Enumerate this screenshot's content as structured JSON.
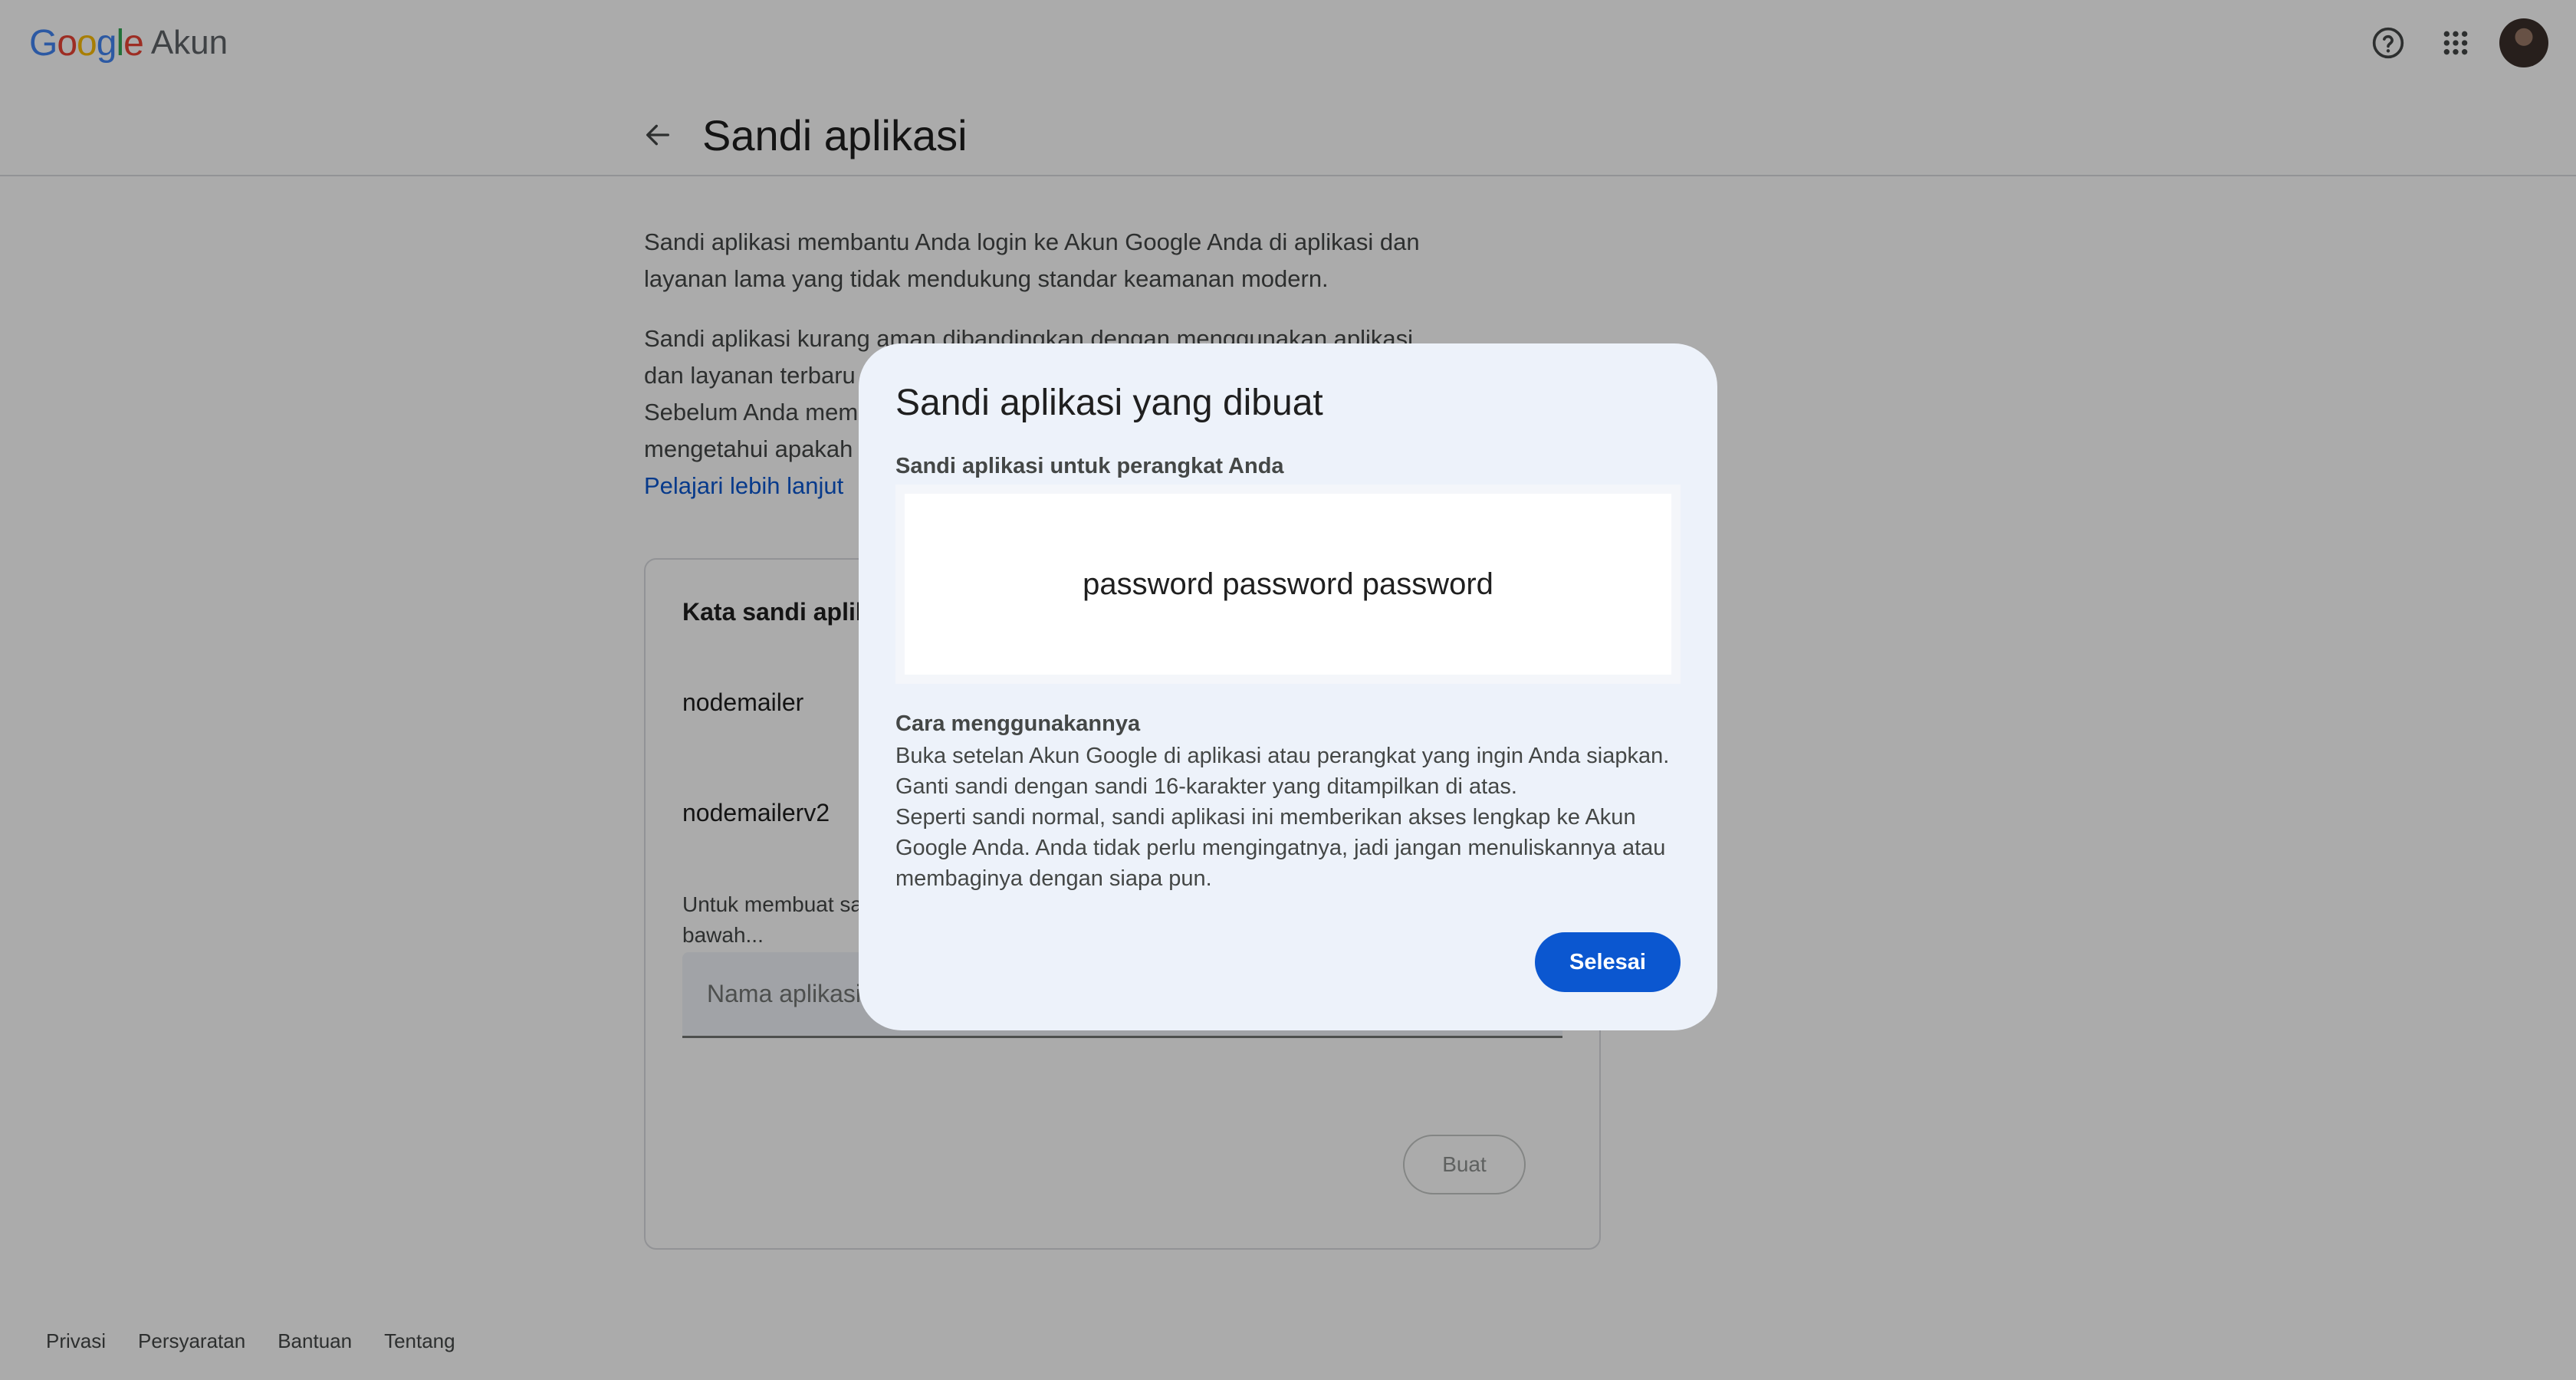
{
  "header": {
    "logo_google": "Google",
    "logo_product": "Akun",
    "help_icon": "help-circle-icon",
    "apps_icon": "apps-grid-icon"
  },
  "page": {
    "title": "Sandi aplikasi",
    "description_1": "Sandi aplikasi membantu Anda login ke Akun Google Anda di aplikasi dan layanan lama yang tidak mendukung standar keamanan modern.",
    "description_2_line1": "Sandi aplikasi kurang aman dibandingkan dengan menggunakan aplikasi",
    "description_2_line2": "dan layanan terbaru",
    "description_2_line3": "Sebelum Anda mem",
    "description_2_line4": "mengetahui apakah",
    "learn_more": "Pelajari lebih lanjut"
  },
  "card": {
    "title": "Kata sandi aplik",
    "apps": [
      "nodemailer",
      "nodemailerv2"
    ],
    "hint_line1": "Untuk membuat sa",
    "hint_line2": "bawah...",
    "input_placeholder": "Nama aplikasi",
    "create_label": "Buat"
  },
  "footer": {
    "links": [
      "Privasi",
      "Persyaratan",
      "Bantuan",
      "Tentang"
    ]
  },
  "dialog": {
    "title": "Sandi aplikasi yang dibuat",
    "subtitle": "Sandi aplikasi untuk perangkat Anda",
    "password": "password password password",
    "how_title": "Cara menggunakannya",
    "how_line1": "Buka setelan Akun Google di aplikasi atau perangkat yang ingin Anda siapkan.",
    "how_line2": "Ganti sandi dengan sandi 16-karakter yang ditampilkan di atas.",
    "how_line3": "Seperti sandi normal, sandi aplikasi ini memberikan akses lengkap ke Akun Google Anda. Anda tidak perlu mengingatnya, jadi jangan menuliskannya atau membaginya dengan siapa pun.",
    "done_label": "Selesai"
  },
  "colors": {
    "primary": "#0b57d0",
    "dialog_bg": "#edf2fa",
    "scrim": "rgba(0,0,0,0.33)"
  }
}
